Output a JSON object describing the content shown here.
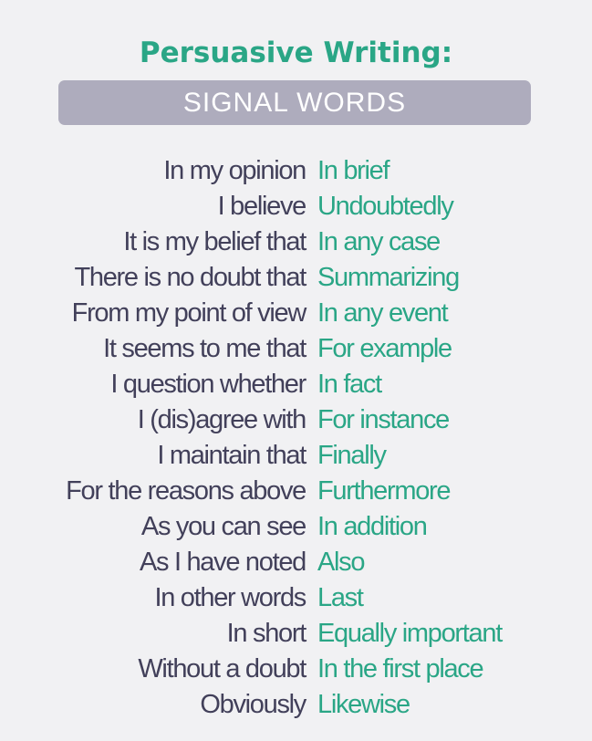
{
  "header": {
    "title": "Persuasive Writing:",
    "banner": "SIGNAL WORDS"
  },
  "colors": {
    "accent": "#2aa686",
    "banner_bg": "#aeacbd",
    "text_dark": "#42405a",
    "background": "#f1f1f3"
  },
  "rows": [
    {
      "left": "In my opinion",
      "right": "In brief"
    },
    {
      "left": "I believe",
      "right": "Undoubtedly"
    },
    {
      "left": "It is my belief that",
      "right": "In any case"
    },
    {
      "left": "There is no doubt that",
      "right": "Summarizing"
    },
    {
      "left": "From my point of view",
      "right": "In any event"
    },
    {
      "left": "It seems to me that",
      "right": "For example"
    },
    {
      "left": "I question whether",
      "right": "In fact"
    },
    {
      "left": "I (dis)agree with",
      "right": "For instance"
    },
    {
      "left": "I maintain that",
      "right": "Finally"
    },
    {
      "left": "For the reasons above",
      "right": "Furthermore"
    },
    {
      "left": "As you can see",
      "right": "In addition"
    },
    {
      "left": "As I have noted",
      "right": "Also"
    },
    {
      "left": "In other words",
      "right": "Last"
    },
    {
      "left": "In short",
      "right": "Equally important"
    },
    {
      "left": "Without a doubt",
      "right": "In the first place"
    },
    {
      "left": "Obviously",
      "right": "Likewise"
    }
  ]
}
